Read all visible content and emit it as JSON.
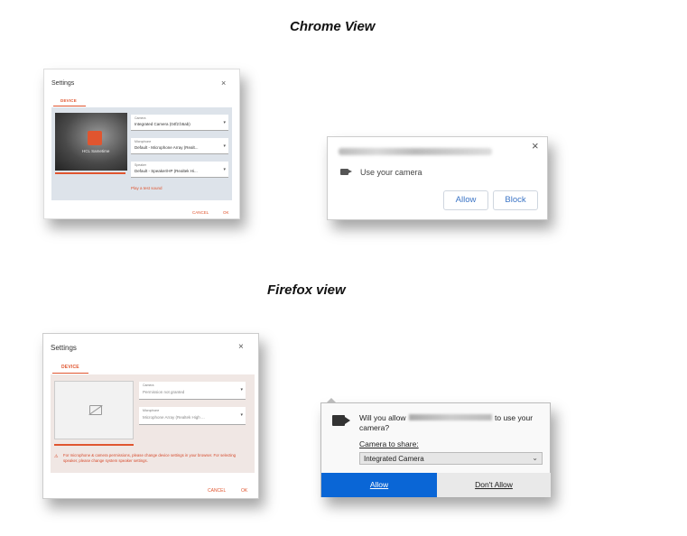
{
  "headings": {
    "chrome": "Chrome View",
    "firefox": "Firefox view"
  },
  "chrome_settings": {
    "title": "Settings",
    "close": "×",
    "tab": "DEVICE",
    "camera": {
      "label": "Camera",
      "value": "Integrated Camera (04f2:b5ab)"
    },
    "microphone": {
      "label": "Microphone",
      "value": "Default - Microphone Array (Realt..."
    },
    "speaker": {
      "label": "Speaker",
      "value": "Default - Speaker/HP (Realtek Hi..."
    },
    "preview_logo_text": "HCL Sametime",
    "test_sound": "Play a test sound",
    "cancel": "CANCEL",
    "ok": "OK"
  },
  "chrome_popup": {
    "close": "×",
    "message": "Use your camera",
    "allow": "Allow",
    "block": "Block"
  },
  "firefox_settings": {
    "title": "Settings",
    "close": "×",
    "tab": "DEVICE",
    "camera": {
      "label": "Camera",
      "value": "Permission not granted"
    },
    "microphone": {
      "label": "Microphone",
      "value": "Microphone Array (Realtek High ..."
    },
    "warning": "For microphone & camera permissions, please change device settings in your browser. For selecting speaker, please change system speaker settings.",
    "cancel": "CANCEL",
    "ok": "OK"
  },
  "firefox_popup": {
    "question_start": "Will you allow",
    "question_end": "to use your",
    "question_line2": "camera?",
    "camera_label": "Camera to share:",
    "camera_value": "Integrated Camera",
    "allow": "Allow",
    "deny": "Don't Allow"
  }
}
